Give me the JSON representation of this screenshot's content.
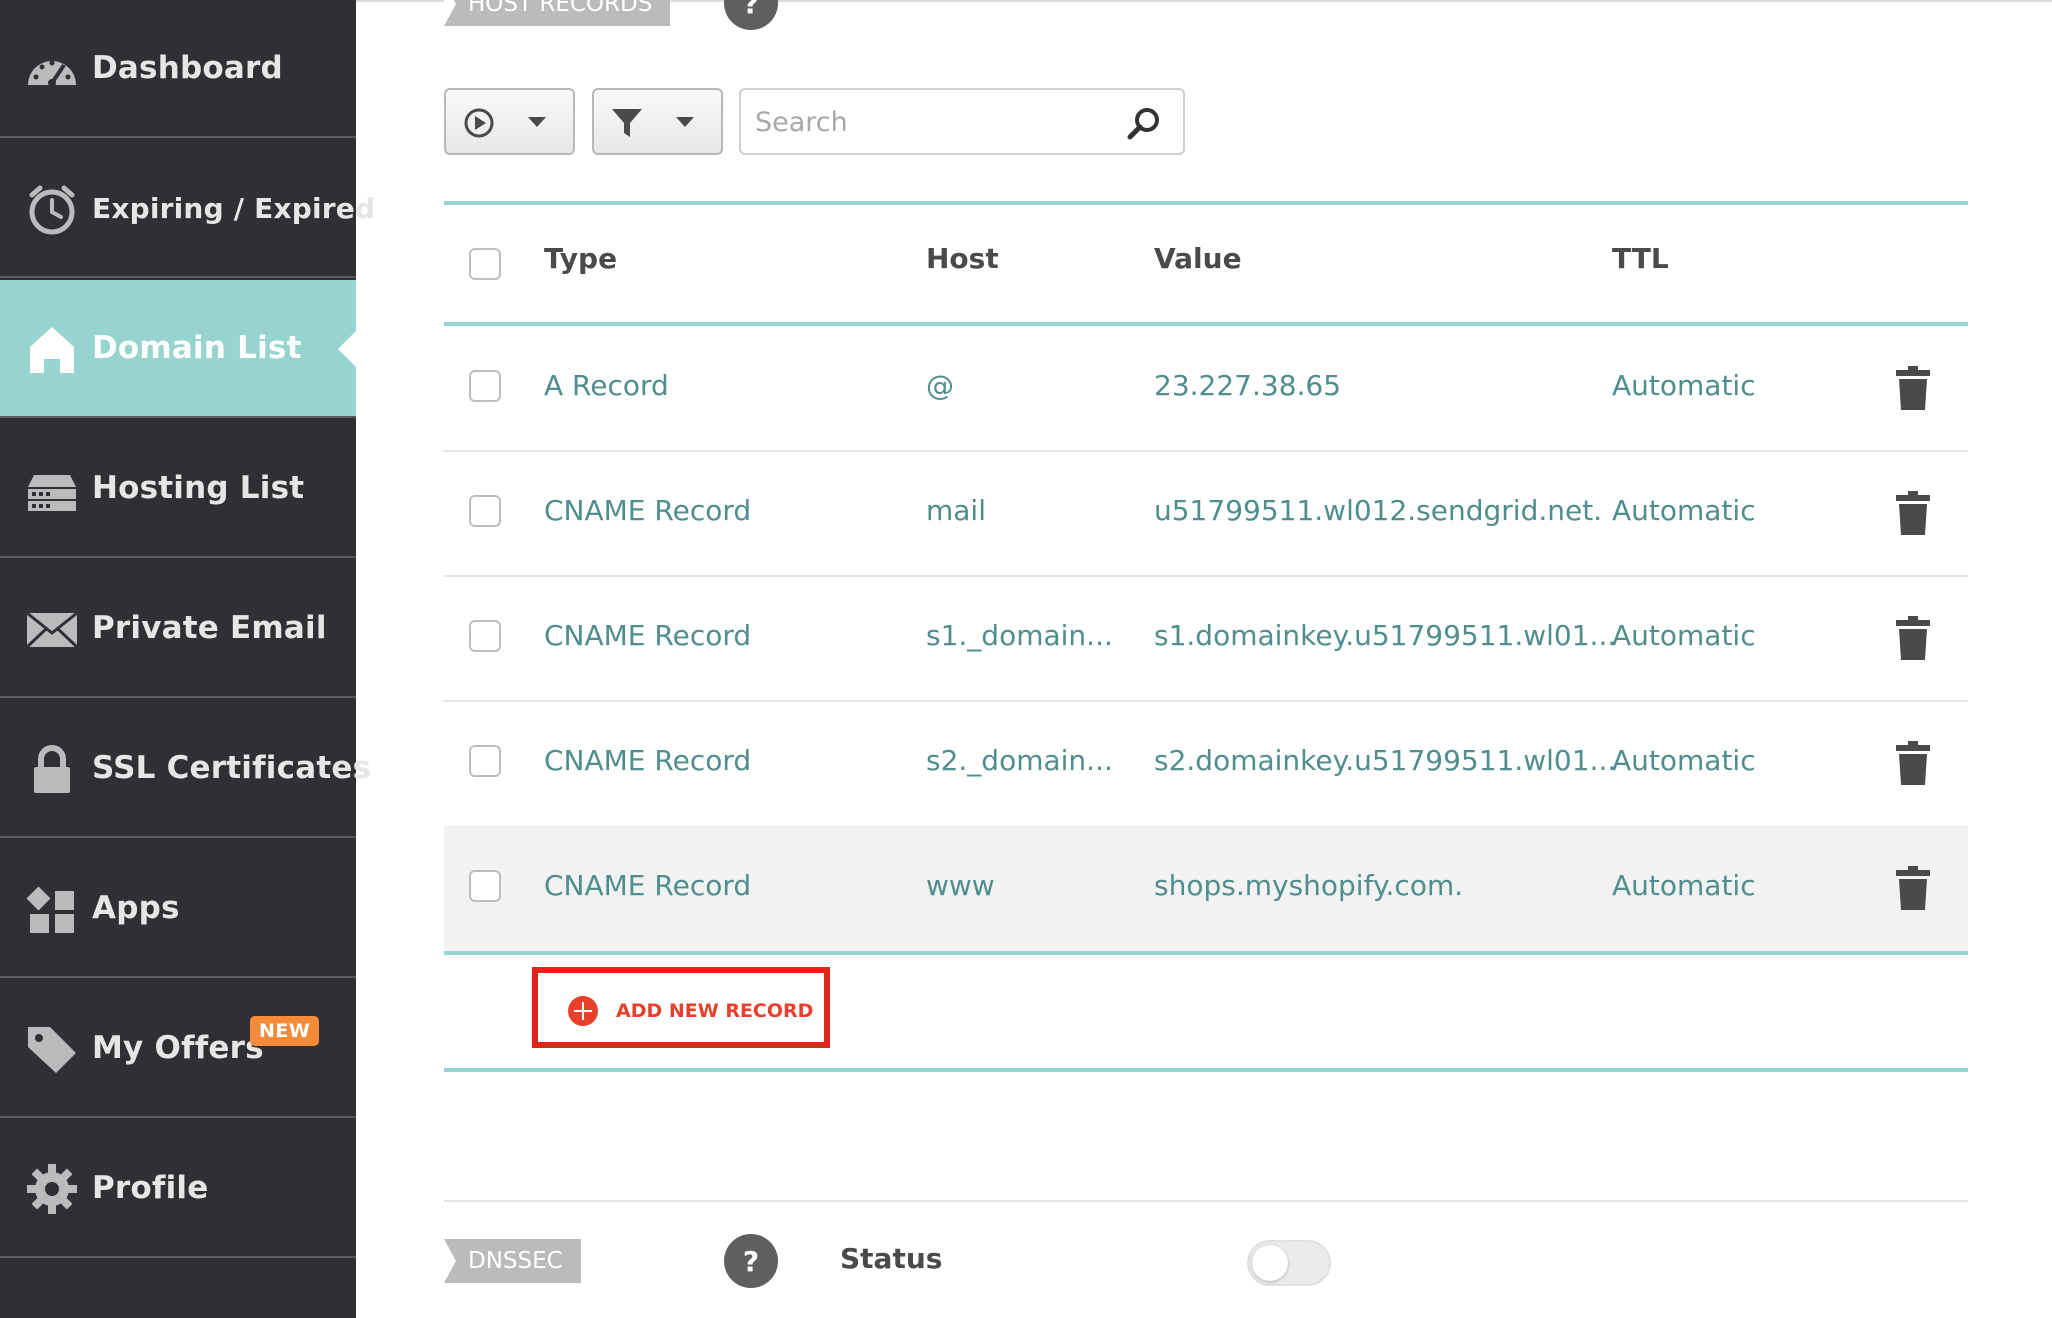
{
  "sidebar": {
    "items": [
      {
        "label": "Dashboard",
        "icon": "gauge-icon"
      },
      {
        "label": "Expiring / Expired",
        "icon": "timer-icon"
      },
      {
        "label": "Domain List",
        "icon": "home-icon",
        "active": true
      },
      {
        "label": "Hosting List",
        "icon": "server-icon"
      },
      {
        "label": "Private Email",
        "icon": "envelope-icon"
      },
      {
        "label": "SSL Certificates",
        "icon": "lock-icon"
      },
      {
        "label": "Apps",
        "icon": "apps-grid-icon"
      },
      {
        "label": "My Offers",
        "icon": "tag-icon",
        "badge": "NEW"
      },
      {
        "label": "Profile",
        "icon": "gear-icon"
      }
    ]
  },
  "host_records": {
    "section_label": "HOST RECORDS",
    "help_label": "?",
    "search": {
      "placeholder": "Search",
      "value": ""
    },
    "columns": {
      "type": "Type",
      "host": "Host",
      "value": "Value",
      "ttl": "TTL"
    },
    "rows": [
      {
        "type": "A Record",
        "host": "@",
        "value": "23.227.38.65",
        "ttl": "Automatic"
      },
      {
        "type": "CNAME Record",
        "host": "mail",
        "value": "u51799511.wl012.sendgrid.net.",
        "ttl": "Automatic"
      },
      {
        "type": "CNAME Record",
        "host": "s1._domain...",
        "value": "s1.domainkey.u51799511.wl01...",
        "ttl": "Automatic"
      },
      {
        "type": "CNAME Record",
        "host": "s2._domain...",
        "value": "s2.domainkey.u51799511.wl01...",
        "ttl": "Automatic"
      },
      {
        "type": "CNAME Record",
        "host": "www",
        "value": "shops.myshopify.com.",
        "ttl": "Automatic",
        "highlighted": true
      }
    ],
    "add_button_label": "ADD NEW RECORD"
  },
  "dnssec": {
    "section_label": "DNSSEC",
    "help_label": "?",
    "status_label": "Status",
    "status_enabled": false
  },
  "colors": {
    "sidebar_bg": "#2e3033",
    "active_bg": "#97d4cf",
    "teal_text": "#4f8e8d",
    "accent_red": "#e02416",
    "badge_orange": "#f58a3a"
  }
}
